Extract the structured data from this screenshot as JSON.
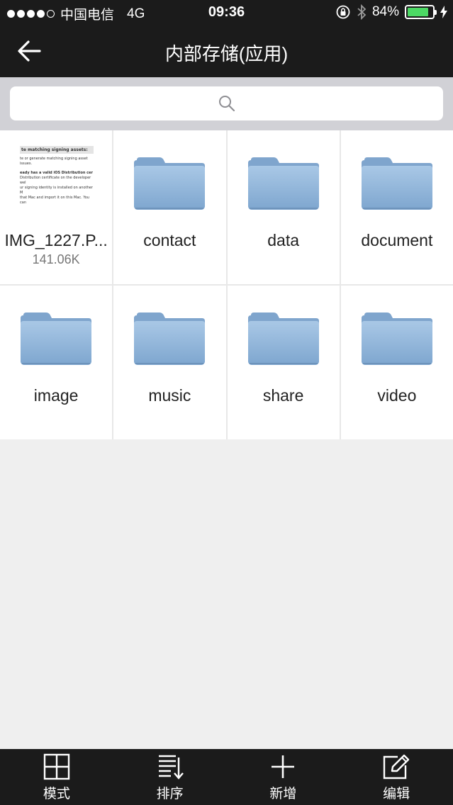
{
  "status_bar": {
    "carrier": "中国电信",
    "network": "4G",
    "time": "09:36",
    "battery_percent": "84%",
    "battery_level": 0.84,
    "icons": [
      "signal-dots-icon",
      "orientation-lock-icon",
      "bluetooth-icon",
      "battery-icon",
      "charging-bolt-icon"
    ]
  },
  "nav": {
    "title": "内部存储(应用)",
    "back_icon": "back-arrow-icon"
  },
  "search": {
    "icon": "search-icon"
  },
  "files": [
    {
      "name": "IMG_1227.P...",
      "size": "141.06K",
      "kind": "image",
      "thumb": {
        "header": "te matching signing assets:",
        "line1": "te or generate matching signing asset",
        "line2": "issues.",
        "bold": "eady has a valid iOS Distribution cer",
        "line3": "Distribution certificate on the developer wel",
        "line4": "ur signing identity is installed on another M",
        "line5": "that Mac and import it on this Mac. You can"
      }
    },
    {
      "name": "contact",
      "kind": "folder"
    },
    {
      "name": "data",
      "kind": "folder"
    },
    {
      "name": "document",
      "kind": "folder"
    },
    {
      "name": "image",
      "kind": "folder"
    },
    {
      "name": "music",
      "kind": "folder"
    },
    {
      "name": "share",
      "kind": "folder"
    },
    {
      "name": "video",
      "kind": "folder"
    }
  ],
  "toolbar": {
    "mode_label": "模式",
    "sort_label": "排序",
    "new_label": "新增",
    "edit_label": "编辑"
  },
  "colors": {
    "bar_bg": "#1b1b1b",
    "page_bg": "#efefef",
    "search_area_bg": "#d1d1d6",
    "battery_green": "#4cd964",
    "folder_blue": "#8fb4d8"
  }
}
